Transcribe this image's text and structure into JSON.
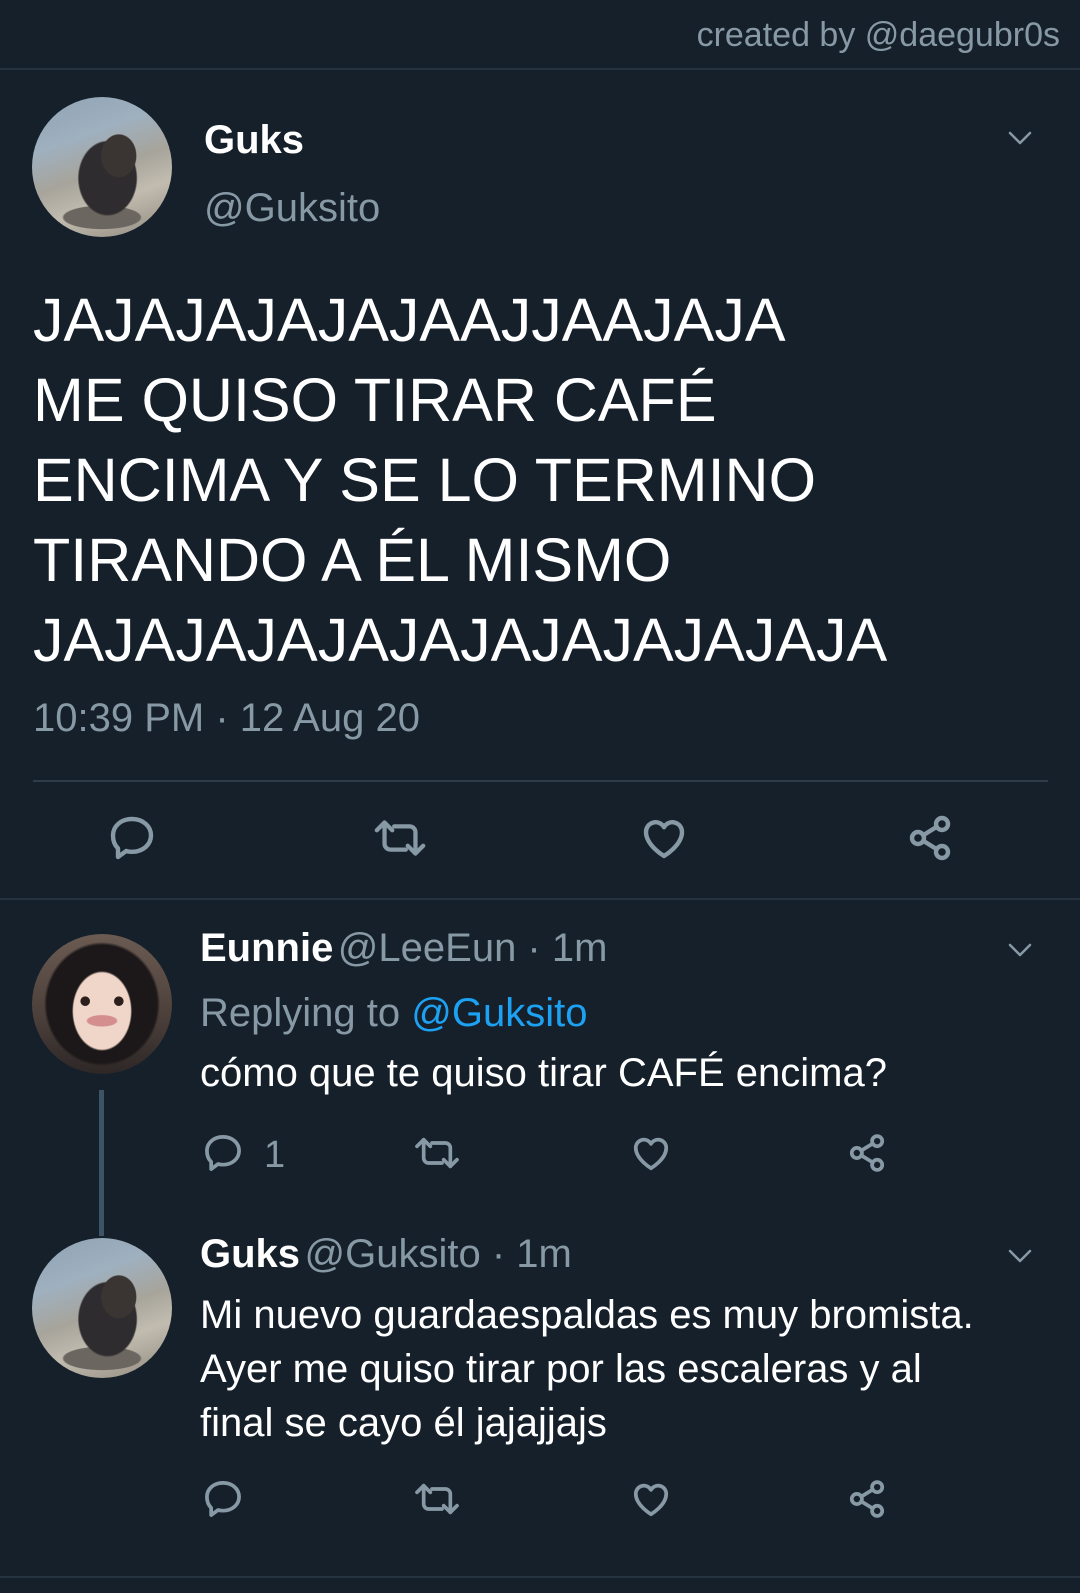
{
  "header": {
    "credit": "created by @daegubr0s"
  },
  "main_tweet": {
    "name": "Guks",
    "handle": "@Guksito",
    "text_lines": [
      "JAJAJAJAJAJAAJJAAJAJA",
      "ME QUISO TIRAR CAFÉ",
      "ENCIMA Y SE LO TERMINO",
      "TIRANDO A ÉL MISMO",
      "JAJAJAJAJAJAJAJAJAJAJAJA"
    ],
    "timestamp": "10:39 PM · 12 Aug 20"
  },
  "reply1": {
    "name": "Eunnie",
    "meta": "@LeeEun · 1m",
    "replying_prefix": "Replying to",
    "replying_to": "@Guksito",
    "text": "cómo que te quiso tirar CAFÉ encima?",
    "reply_count": "1"
  },
  "reply2": {
    "name": "Guks",
    "meta": "@Guksito · 1m",
    "text_lines": [
      "Mi nuevo guardaespaldas es muy bromista.",
      "Ayer me quiso tirar por las escaleras y al",
      "final se cayo él jajajjajs"
    ]
  },
  "icons": {
    "reply": "speech-bubble-icon",
    "retweet": "retweet-icon",
    "like": "heart-icon",
    "share": "share-icon",
    "more": "chevron-down-icon"
  }
}
